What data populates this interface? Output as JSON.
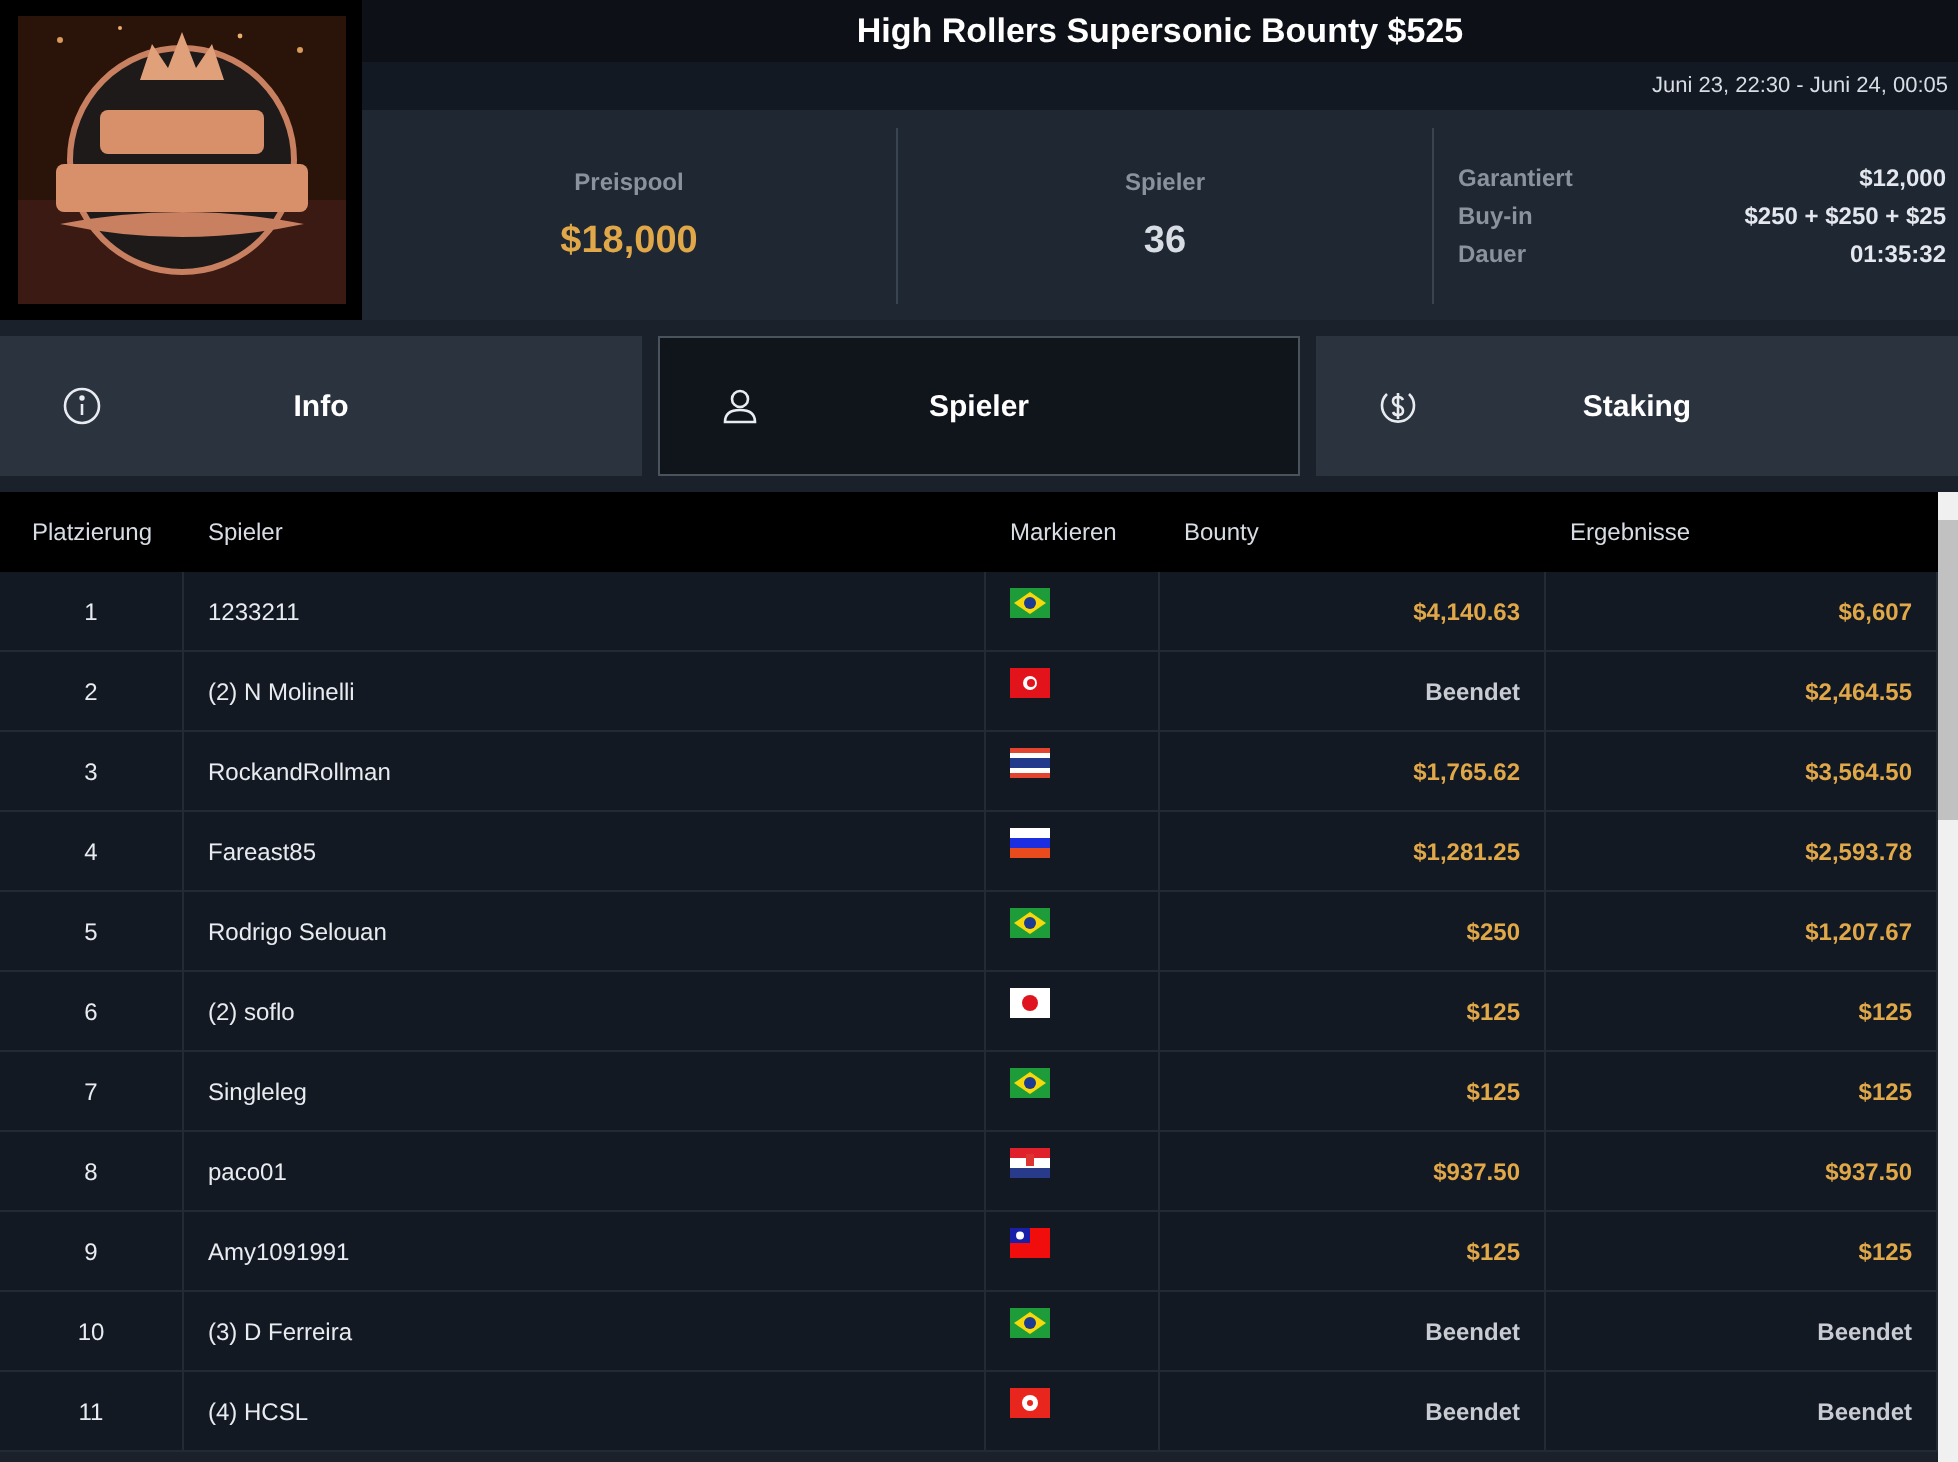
{
  "title": "High Rollers Supersonic Bounty $525",
  "dates": "Juni 23, 22:30 - Juni 24, 00:05",
  "stats": [
    {
      "label": "Preispool",
      "value": "$18,000",
      "highlight": true
    },
    {
      "label": "Spieler",
      "value": "36",
      "highlight": false
    }
  ],
  "details": [
    {
      "label": "Garantiert",
      "value": "$12,000"
    },
    {
      "label": "Buy-in",
      "value": "$250 + $250 + $25"
    },
    {
      "label": "Dauer",
      "value": "01:35:32"
    }
  ],
  "tabs": [
    {
      "label": "Info",
      "kind": "info",
      "selected": false
    },
    {
      "label": "Spieler",
      "kind": "user",
      "selected": true
    },
    {
      "label": "Staking",
      "kind": "dollar",
      "selected": false
    }
  ],
  "table": {
    "columns": [
      "Platzierung",
      "Spieler",
      "Markieren",
      "Bounty",
      "Ergebnisse"
    ],
    "rows": [
      {
        "place": "1",
        "player": "1233211",
        "flag": {
          "kind": "brazil"
        },
        "bounty": {
          "text": "$4,140.63",
          "finished": false
        },
        "result": {
          "text": "$6,607",
          "finished": false
        }
      },
      {
        "place": "2",
        "player": "(2) N Molinelli",
        "flag": {
          "kind": "tunisia"
        },
        "bounty": {
          "text": "Beendet",
          "finished": true
        },
        "result": {
          "text": "$2,464.55",
          "finished": false
        }
      },
      {
        "place": "3",
        "player": "RockandRollman",
        "flag": {
          "kind": "thailand"
        },
        "bounty": {
          "text": "$1,765.62",
          "finished": false
        },
        "result": {
          "text": "$3,564.50",
          "finished": false
        }
      },
      {
        "place": "4",
        "player": "Fareast85",
        "flag": {
          "kind": "russia"
        },
        "bounty": {
          "text": "$1,281.25",
          "finished": false
        },
        "result": {
          "text": "$2,593.78",
          "finished": false
        }
      },
      {
        "place": "5",
        "player": "Rodrigo Selouan",
        "flag": {
          "kind": "brazil"
        },
        "bounty": {
          "text": "$250",
          "finished": false
        },
        "result": {
          "text": "$1,207.67",
          "finished": false
        }
      },
      {
        "place": "6",
        "player": "(2) soflo",
        "flag": {
          "kind": "japan"
        },
        "bounty": {
          "text": "$125",
          "finished": false
        },
        "result": {
          "text": "$125",
          "finished": false
        }
      },
      {
        "place": "7",
        "player": "Singleleg",
        "flag": {
          "kind": "brazil"
        },
        "bounty": {
          "text": "$125",
          "finished": false
        },
        "result": {
          "text": "$125",
          "finished": false
        }
      },
      {
        "place": "8",
        "player": "paco01",
        "flag": {
          "kind": "croatia"
        },
        "bounty": {
          "text": "$937.50",
          "finished": false
        },
        "result": {
          "text": "$937.50",
          "finished": false
        }
      },
      {
        "place": "9",
        "player": "Amy1091991",
        "flag": {
          "kind": "taiwan"
        },
        "bounty": {
          "text": "$125",
          "finished": false
        },
        "result": {
          "text": "$125",
          "finished": false
        }
      },
      {
        "place": "10",
        "player": "(3) D Ferreira",
        "flag": {
          "kind": "brazil"
        },
        "bounty": {
          "text": "Beendet",
          "finished": true
        },
        "result": {
          "text": "Beendet",
          "finished": true
        }
      },
      {
        "place": "11",
        "player": "(4) HCSL",
        "flag": {
          "kind": "hongkong"
        },
        "bounty": {
          "text": "Beendet",
          "finished": true
        },
        "result": {
          "text": "Beendet",
          "finished": true
        }
      }
    ]
  }
}
